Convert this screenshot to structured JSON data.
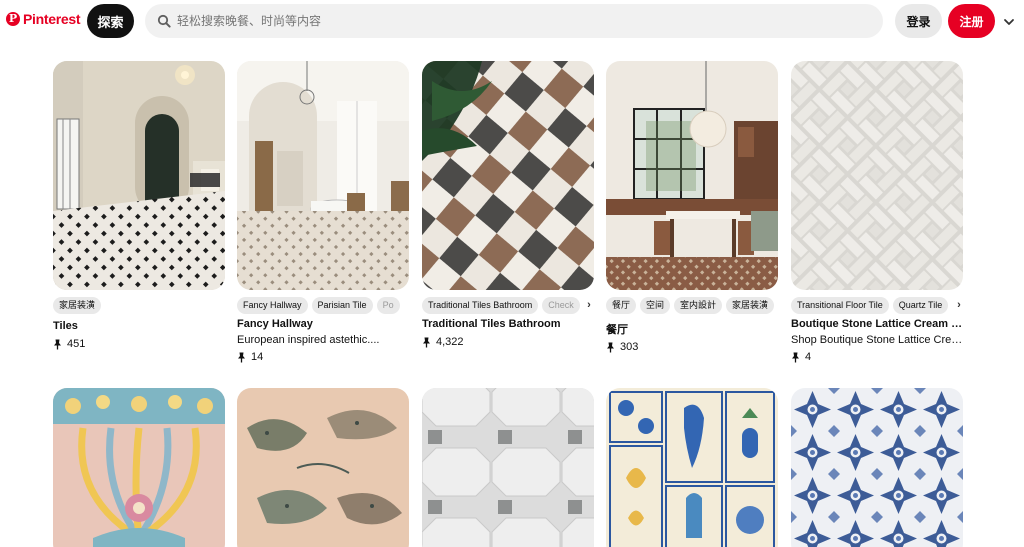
{
  "brand": {
    "name": "Pinterest",
    "color": "#e60023"
  },
  "header": {
    "explore_label": "探索",
    "search_placeholder": "轻松搜索晚餐、时尚等内容",
    "login_label": "登录",
    "signup_label": "注册"
  },
  "icons": {
    "logo": "pinterest-logo-icon",
    "search": "search-icon",
    "menu": "chevron-down-icon",
    "saves": "pushpin-icon",
    "tag_scroll": "chevron-right-icon"
  },
  "pins": [
    {
      "tags": [
        "家居装潢"
      ],
      "title": "Tiles",
      "description": "",
      "saves": "451"
    },
    {
      "tags": [
        "Fancy Hallway",
        "Parisian Tile",
        "Po"
      ],
      "title": "Fancy Hallway",
      "description": "European inspired astethic....",
      "saves": "14"
    },
    {
      "tags": [
        "Traditional Tiles Bathroom",
        "Check"
      ],
      "title": "Traditional Tiles Bathroom",
      "description": "",
      "saves": "4,322"
    },
    {
      "tags": [
        "餐厅",
        "空间",
        "室内設計",
        "家居装潢"
      ],
      "title": "餐厅",
      "description": "",
      "saves": "303"
    },
    {
      "tags": [
        "Transitional Floor Tile",
        "Quartz Tile"
      ],
      "title": "Boutique Stone Lattice Cream 11...",
      "description": "Shop Boutique Stone Lattice Crea...",
      "saves": "4"
    }
  ]
}
